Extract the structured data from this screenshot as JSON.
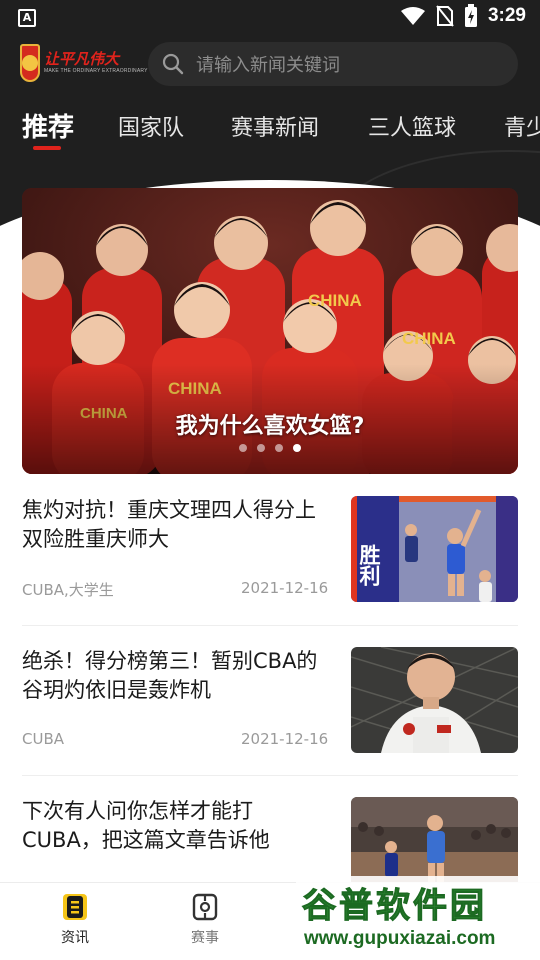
{
  "status_bar": {
    "time": "3:29",
    "notification_glyph": "A"
  },
  "app": {
    "logo_text_cn": "让平凡伟大",
    "logo_text_en": "MAKE THE ORDINARY EXTRAORDINARY"
  },
  "search": {
    "placeholder": "请输入新闻关键词"
  },
  "tabs": [
    {
      "label": "推荐",
      "active": true
    },
    {
      "label": "国家队"
    },
    {
      "label": "赛事新闻"
    },
    {
      "label": "三人篮球"
    },
    {
      "label": "青少"
    }
  ],
  "banner": {
    "caption": "我为什么喜欢女篮?",
    "jersey_text": "CHINA",
    "page_count": 4,
    "active_page": 4
  },
  "news": [
    {
      "title": "焦灼对抗！重庆文理四人得分上双险胜重庆师大",
      "tag": "CUBA,大学生",
      "date": "2021-12-16",
      "thumb_text": "胜利"
    },
    {
      "title": "绝杀！得分榜第三！暂别CBA的谷玥灼依旧是轰炸机",
      "tag": "CUBA",
      "date": "2021-12-16"
    },
    {
      "title": "下次有人问你怎样才能打CUBA，把这篇文章告诉他",
      "tag": "",
      "date": ""
    }
  ],
  "bottom_nav": [
    {
      "label": "资讯",
      "icon": "news-icon",
      "active": true
    },
    {
      "label": "赛事",
      "icon": "match-icon",
      "active": false
    }
  ],
  "watermark": {
    "title": "谷普软件园",
    "url": "www.gupuxiazai.com"
  },
  "colors": {
    "accent": "#e0231c",
    "header_bg": "#1f1f1f",
    "jersey_red": "#d72a22",
    "jersey_yellow": "#f2c94c",
    "nav_active": "#f5c518"
  }
}
